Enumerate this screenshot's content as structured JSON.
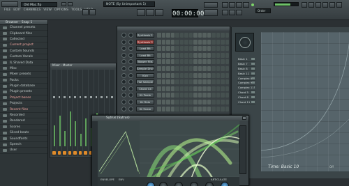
{
  "toolbar": {
    "title": "Old Mac.flp",
    "menu": [
      "FILE",
      "EDIT",
      "CHANNELS",
      "VIEW",
      "OPTIONS",
      "TOOLS",
      "HELP"
    ],
    "song_name": "NOTE (Sy Unimportant 1)",
    "time": "00:00:00",
    "cpu": "Order"
  },
  "browser": {
    "title": "Browser - Snap 1",
    "items": [
      {
        "label": "Channel presets",
        "active": false
      },
      {
        "label": "Clipboard files",
        "active": false
      },
      {
        "label": "Collected",
        "active": false
      },
      {
        "label": "Current project",
        "active": true
      },
      {
        "label": "Custom Sounds",
        "active": false
      },
      {
        "label": "Custom Vocals",
        "active": false
      },
      {
        "label": "IL Shared Data",
        "active": false
      },
      {
        "label": "Misc",
        "active": false
      },
      {
        "label": "Mixer presets",
        "active": false
      },
      {
        "label": "Packs",
        "active": false
      },
      {
        "label": "Plugin database",
        "active": false
      },
      {
        "label": "Plugin presets",
        "active": false
      },
      {
        "label": "Project bones",
        "active": true
      },
      {
        "label": "Projects",
        "active": false
      },
      {
        "label": "Recent files",
        "active": true
      },
      {
        "label": "Recorded",
        "active": false
      },
      {
        "label": "Rendered",
        "active": false
      },
      {
        "label": "Scores",
        "active": false
      },
      {
        "label": "Sliced beats",
        "active": false
      },
      {
        "label": "Soundfonts",
        "active": false
      },
      {
        "label": "Speech",
        "active": false
      },
      {
        "label": "User",
        "active": false
      }
    ]
  },
  "mixer": {
    "title": "Mixer - Master"
  },
  "stepseq": {
    "channels": [
      {
        "name": "Synthesis 1",
        "selected": false
      },
      {
        "name": "Synthesis 2",
        "selected": true
      },
      {
        "name": "Lead Bit",
        "selected": false
      },
      {
        "name": "Lead Bit",
        "selected": false
      },
      {
        "name": "Blower Fills",
        "selected": false
      },
      {
        "name": "Sample Drum",
        "selected": false
      },
      {
        "name": "Kick",
        "selected": false
      },
      {
        "name": "Hat Sample",
        "selected": false
      },
      {
        "name": "Chord C4",
        "selected": false
      },
      {
        "name": "KL Tomb",
        "selected": false
      },
      {
        "name": "KL Ride",
        "selected": false
      },
      {
        "name": "KL Snare",
        "selected": false
      }
    ]
  },
  "pianoroll": {
    "patterns": [
      "Basic 1",
      "Basic 7",
      "Basic 8",
      "Basic 11",
      "Complex 8",
      "Complex 9",
      "Complex 11",
      "Chord 5",
      "Chord 8",
      "Chord 11"
    ],
    "time_label": "Time: Basic 10",
    "zoom_label": "Off"
  },
  "plugin": {
    "title": "Sytrus (Sytrus)",
    "bottom_values": [
      "ENVELOPE",
      "ENV",
      "ARTICULATE"
    ]
  }
}
